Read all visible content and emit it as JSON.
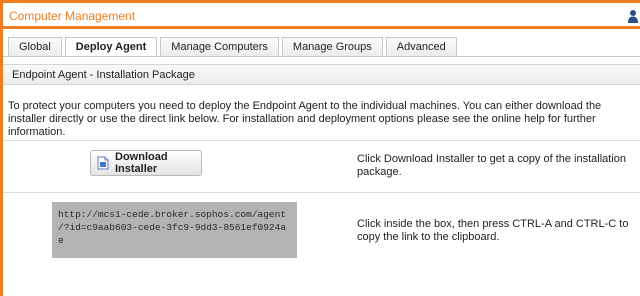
{
  "window": {
    "title": "Computer Management",
    "accent_color": "#ef7d22",
    "user_icon": "user-icon"
  },
  "tabs": [
    {
      "label": "Global",
      "active": false
    },
    {
      "label": "Deploy Agent",
      "active": true
    },
    {
      "label": "Manage Computers",
      "active": false
    },
    {
      "label": "Manage Groups",
      "active": false
    },
    {
      "label": "Advanced",
      "active": false
    }
  ],
  "section": {
    "title": "Endpoint Agent - Installation Package"
  },
  "intro_text": "To protect your computers you need to deploy the Endpoint Agent to the individual machines. You can either download the installer directly or use the direct link below. For installation and deployment options please see the online help for further information.",
  "download": {
    "button_label": "Download Installer",
    "icon": "download-installer-icon",
    "help_text": "Click Download Installer to get a copy of the installation package."
  },
  "direct_link": {
    "url_line1": "http://mcs1-cede.broker.sophos.com/agent",
    "url_line2": "/?id=c9aab603-cede-3fc9-9dd3-8561ef0924ae",
    "help_text": "Click inside the box, then press CTRL-A and CTRL-C to copy the link to the clipboard."
  }
}
